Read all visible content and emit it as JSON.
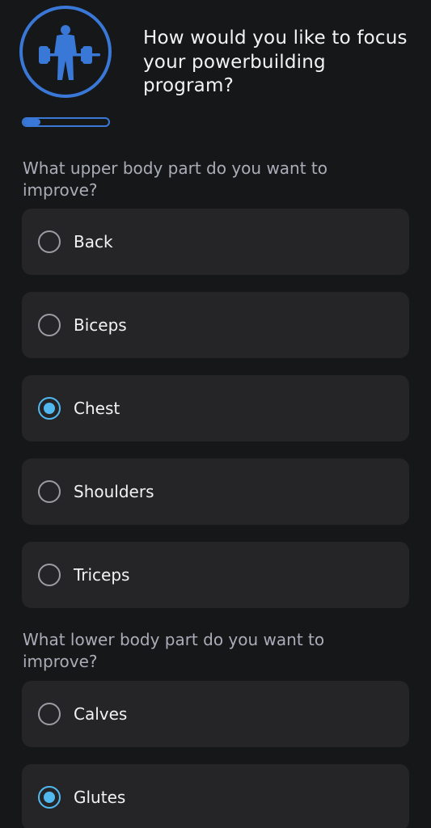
{
  "header": {
    "logo_icon": "powerlifter-barbell-icon",
    "title": "How would you like to focus your powerbuilding program?",
    "progress_fraction": 0.2
  },
  "upper": {
    "question": "What upper body part do you want to improve?",
    "options": [
      {
        "label": "Back",
        "selected": false
      },
      {
        "label": "Biceps",
        "selected": false
      },
      {
        "label": "Chest",
        "selected": true
      },
      {
        "label": "Shoulders",
        "selected": false
      },
      {
        "label": "Triceps",
        "selected": false
      }
    ]
  },
  "lower": {
    "question": "What lower body part do you want to improve?",
    "options": [
      {
        "label": "Calves",
        "selected": false
      },
      {
        "label": "Glutes",
        "selected": true
      }
    ]
  },
  "colors": {
    "accent": "#3a78d8",
    "selected": "#52b9f0",
    "card": "#252528",
    "background": "#161719"
  }
}
